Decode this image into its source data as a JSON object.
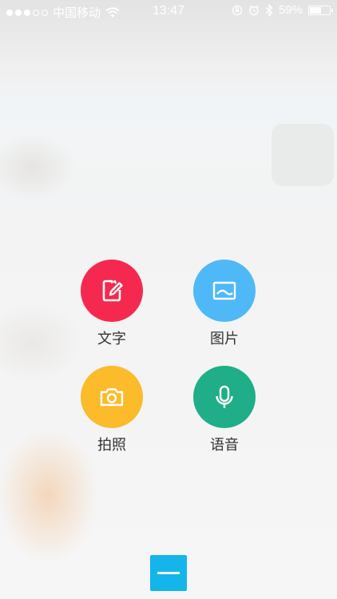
{
  "status_bar": {
    "signal_dots_filled": 3,
    "signal_dots_total": 5,
    "carrier": "中国移动",
    "time": "13:47",
    "battery": "59%",
    "battery_level": 0.59
  },
  "actions": [
    {
      "label": "文字",
      "icon": "edit-note-icon",
      "color": "#f5294f"
    },
    {
      "label": "图片",
      "icon": "image-icon",
      "color": "#4fb9f7"
    },
    {
      "label": "拍照",
      "icon": "camera-icon",
      "color": "#fbbb2a"
    },
    {
      "label": "语音",
      "icon": "microphone-icon",
      "color": "#1fae87"
    }
  ],
  "close_button": {
    "color": "#13b5ea",
    "icon": "minus-icon"
  }
}
